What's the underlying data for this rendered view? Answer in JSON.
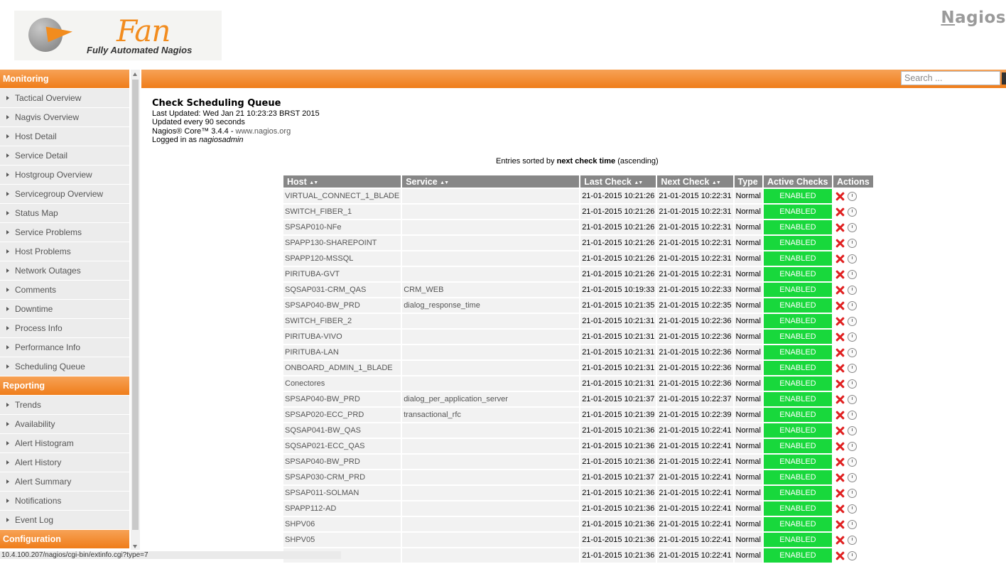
{
  "header": {
    "logo_word": "Fan",
    "logo_tagline": "Fully Automated Nagios",
    "brand_first": "N",
    "brand_rest": "agios"
  },
  "sidebar": {
    "monitoring_title": "Monitoring",
    "monitoring_items": [
      "Tactical Overview",
      "Nagvis Overview",
      "Host Detail",
      "Service Detail",
      "Hostgroup Overview",
      "Servicegroup Overview",
      "Status Map",
      "Service Problems",
      "Host Problems",
      "Network Outages",
      "Comments",
      "Downtime",
      "Process Info",
      "Performance Info",
      "Scheduling Queue"
    ],
    "reporting_title": "Reporting",
    "reporting_items": [
      "Trends",
      "Availability",
      "Alert Histogram",
      "Alert History",
      "Alert Summary",
      "Notifications",
      "Event Log"
    ],
    "configuration_title": "Configuration"
  },
  "search": {
    "placeholder": "Search ..."
  },
  "info": {
    "title": "Check Scheduling Queue",
    "last_updated": "Last Updated: Wed Jan 21 10:23:23 BRST 2015",
    "update_interval": "Updated every 90 seconds",
    "version_prefix": "Nagios® Core™ 3.4.4 - ",
    "version_link": "www.nagios.org",
    "logged_prefix": "Logged in as ",
    "logged_user": "nagiosadmin"
  },
  "sort_note": {
    "prefix": "Entries sorted by ",
    "field": "next check time",
    "suffix": " (ascending)"
  },
  "table": {
    "columns": [
      "Host",
      "Service",
      "Last Check",
      "Next Check",
      "Type",
      "Active Checks",
      "Actions"
    ],
    "sort_arrows": "▲▼",
    "rows": [
      {
        "host": "VIRTUAL_CONNECT_1_BLADE",
        "service": "",
        "last": "21-01-2015 10:21:26",
        "next": "21-01-2015 10:22:31",
        "type": "Normal",
        "active": "ENABLED"
      },
      {
        "host": "SWITCH_FIBER_1",
        "service": "",
        "last": "21-01-2015 10:21:26",
        "next": "21-01-2015 10:22:31",
        "type": "Normal",
        "active": "ENABLED"
      },
      {
        "host": "SPSAP010-NFe",
        "service": "",
        "last": "21-01-2015 10:21:26",
        "next": "21-01-2015 10:22:31",
        "type": "Normal",
        "active": "ENABLED"
      },
      {
        "host": "SPAPP130-SHAREPOINT",
        "service": "",
        "last": "21-01-2015 10:21:26",
        "next": "21-01-2015 10:22:31",
        "type": "Normal",
        "active": "ENABLED"
      },
      {
        "host": "SPAPP120-MSSQL",
        "service": "",
        "last": "21-01-2015 10:21:26",
        "next": "21-01-2015 10:22:31",
        "type": "Normal",
        "active": "ENABLED"
      },
      {
        "host": "PIRITUBA-GVT",
        "service": "",
        "last": "21-01-2015 10:21:26",
        "next": "21-01-2015 10:22:31",
        "type": "Normal",
        "active": "ENABLED"
      },
      {
        "host": "SQSAP031-CRM_QAS",
        "service": "CRM_WEB",
        "last": "21-01-2015 10:19:33",
        "next": "21-01-2015 10:22:33",
        "type": "Normal",
        "active": "ENABLED"
      },
      {
        "host": "SPSAP040-BW_PRD",
        "service": "dialog_response_time",
        "last": "21-01-2015 10:21:35",
        "next": "21-01-2015 10:22:35",
        "type": "Normal",
        "active": "ENABLED"
      },
      {
        "host": "SWITCH_FIBER_2",
        "service": "",
        "last": "21-01-2015 10:21:31",
        "next": "21-01-2015 10:22:36",
        "type": "Normal",
        "active": "ENABLED"
      },
      {
        "host": "PIRITUBA-VIVO",
        "service": "",
        "last": "21-01-2015 10:21:31",
        "next": "21-01-2015 10:22:36",
        "type": "Normal",
        "active": "ENABLED"
      },
      {
        "host": "PIRITUBA-LAN",
        "service": "",
        "last": "21-01-2015 10:21:31",
        "next": "21-01-2015 10:22:36",
        "type": "Normal",
        "active": "ENABLED"
      },
      {
        "host": "ONBOARD_ADMIN_1_BLADE",
        "service": "",
        "last": "21-01-2015 10:21:31",
        "next": "21-01-2015 10:22:36",
        "type": "Normal",
        "active": "ENABLED"
      },
      {
        "host": "Conectores",
        "service": "",
        "last": "21-01-2015 10:21:31",
        "next": "21-01-2015 10:22:36",
        "type": "Normal",
        "active": "ENABLED"
      },
      {
        "host": "SPSAP040-BW_PRD",
        "service": "dialog_per_application_server",
        "last": "21-01-2015 10:21:37",
        "next": "21-01-2015 10:22:37",
        "type": "Normal",
        "active": "ENABLED"
      },
      {
        "host": "SPSAP020-ECC_PRD",
        "service": "transactional_rfc",
        "last": "21-01-2015 10:21:39",
        "next": "21-01-2015 10:22:39",
        "type": "Normal",
        "active": "ENABLED"
      },
      {
        "host": "SQSAP041-BW_QAS",
        "service": "",
        "last": "21-01-2015 10:21:36",
        "next": "21-01-2015 10:22:41",
        "type": "Normal",
        "active": "ENABLED"
      },
      {
        "host": "SQSAP021-ECC_QAS",
        "service": "",
        "last": "21-01-2015 10:21:36",
        "next": "21-01-2015 10:22:41",
        "type": "Normal",
        "active": "ENABLED"
      },
      {
        "host": "SPSAP040-BW_PRD",
        "service": "",
        "last": "21-01-2015 10:21:36",
        "next": "21-01-2015 10:22:41",
        "type": "Normal",
        "active": "ENABLED"
      },
      {
        "host": "SPSAP030-CRM_PRD",
        "service": "",
        "last": "21-01-2015 10:21:37",
        "next": "21-01-2015 10:22:41",
        "type": "Normal",
        "active": "ENABLED"
      },
      {
        "host": "SPSAP011-SOLMAN",
        "service": "",
        "last": "21-01-2015 10:21:36",
        "next": "21-01-2015 10:22:41",
        "type": "Normal",
        "active": "ENABLED"
      },
      {
        "host": "SPAPP112-AD",
        "service": "",
        "last": "21-01-2015 10:21:36",
        "next": "21-01-2015 10:22:41",
        "type": "Normal",
        "active": "ENABLED"
      },
      {
        "host": "SHPV06",
        "service": "",
        "last": "21-01-2015 10:21:36",
        "next": "21-01-2015 10:22:41",
        "type": "Normal",
        "active": "ENABLED"
      },
      {
        "host": "SHPV05",
        "service": "",
        "last": "21-01-2015 10:21:36",
        "next": "21-01-2015 10:22:41",
        "type": "Normal",
        "active": "ENABLED"
      },
      {
        "host": "",
        "service": "",
        "last": "21-01-2015 10:21:36",
        "next": "21-01-2015 10:22:41",
        "type": "Normal",
        "active": "ENABLED"
      }
    ]
  },
  "statusbar": {
    "text": "10.4.100.207/nagios/cgi-bin/extinfo.cgi?type=7"
  },
  "colors": {
    "accent_orange": "#ef7d1a",
    "enabled_green": "#18d83c",
    "header_gray": "#878787",
    "delete_red": "#e02020"
  },
  "icons": {
    "delete": "close-x-icon",
    "reschedule": "clock-icon"
  }
}
